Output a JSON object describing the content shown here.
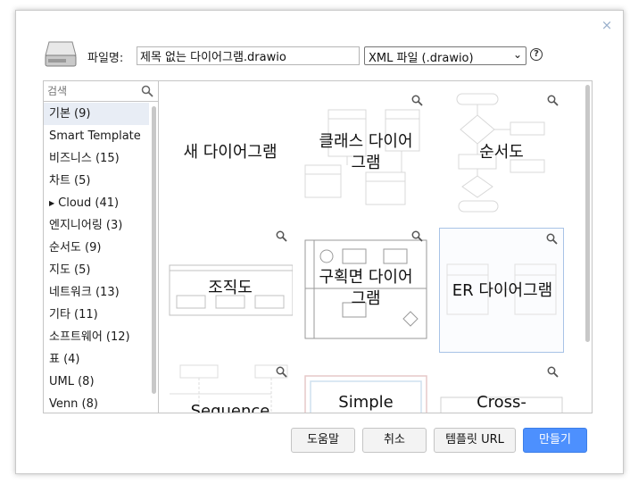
{
  "dialog": {
    "close_glyph": "×",
    "filename_label": "파일명:",
    "filename_value": "제목 없는 다이어그램.drawio",
    "format_selected": "XML 파일 (.drawio)",
    "help_glyph": "?"
  },
  "sidebar": {
    "search_placeholder": "검색",
    "categories": [
      {
        "label": "기본 (9)",
        "selected": true
      },
      {
        "label": "Smart Template"
      },
      {
        "label": "비즈니스 (15)"
      },
      {
        "label": "차트 (5)"
      },
      {
        "label": "Cloud (41)",
        "expandable": true
      },
      {
        "label": "엔지니어링 (3)"
      },
      {
        "label": "순서도 (9)"
      },
      {
        "label": "지도 (5)"
      },
      {
        "label": "네트워크 (13)"
      },
      {
        "label": "기타 (11)"
      },
      {
        "label": "소프트웨어 (12)"
      },
      {
        "label": "표 (4)"
      },
      {
        "label": "UML (8)"
      },
      {
        "label": "Venn (8)"
      }
    ],
    "expand_glyph": "▶"
  },
  "templates": [
    {
      "label": "새 다이어그램"
    },
    {
      "label": "클래스 다이어그램"
    },
    {
      "label": "순서도"
    },
    {
      "label": "조직도"
    },
    {
      "label": "구획면 다이어그램"
    },
    {
      "label": "ER 다이어그램",
      "selected": true
    },
    {
      "label": "Sequence"
    },
    {
      "label": "Simple"
    },
    {
      "label": "Cross-"
    }
  ],
  "buttons": {
    "help": "도움말",
    "cancel": "취소",
    "template_url": "템플릿 URL",
    "create": "만들기"
  },
  "colors": {
    "primary": "#4d90fe",
    "selected_tile_border": "#a8c3e6",
    "selected_category_bg": "#e8edf5"
  }
}
